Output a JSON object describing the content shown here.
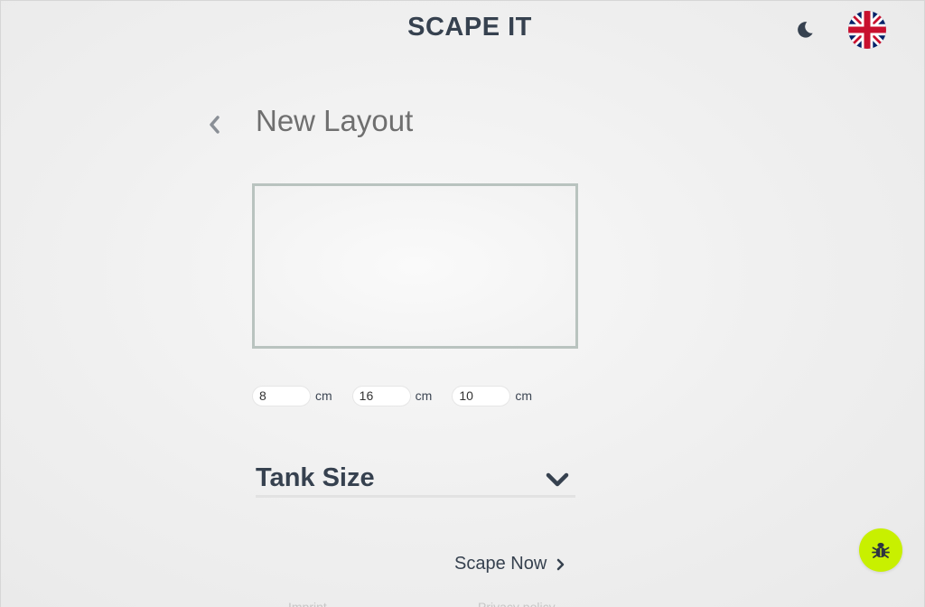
{
  "header": {
    "title": "SCAPE IT",
    "theme_icon": "moon-icon",
    "language_icon": "uk-flag-icon"
  },
  "page": {
    "title": "New Layout",
    "back_icon": "chevron-left-icon"
  },
  "dimensions": [
    {
      "value": "8",
      "unit": "cm"
    },
    {
      "value": "16",
      "unit": "cm"
    },
    {
      "value": "10",
      "unit": "cm"
    }
  ],
  "accordion": {
    "label": "Tank Size",
    "icon": "chevron-down-icon"
  },
  "action": {
    "label": "Scape Now",
    "icon": "chevron-right-icon"
  },
  "footer": {
    "imprint": "Imprint",
    "privacy": "Privacy policy"
  },
  "bug_report": {
    "icon": "bug-icon",
    "color": "#c8f000"
  },
  "colors": {
    "text_dark": "#36414f",
    "title_gray": "#6f6f6f",
    "preview_border": "#b9c3bf",
    "accent": "#c8f000"
  }
}
